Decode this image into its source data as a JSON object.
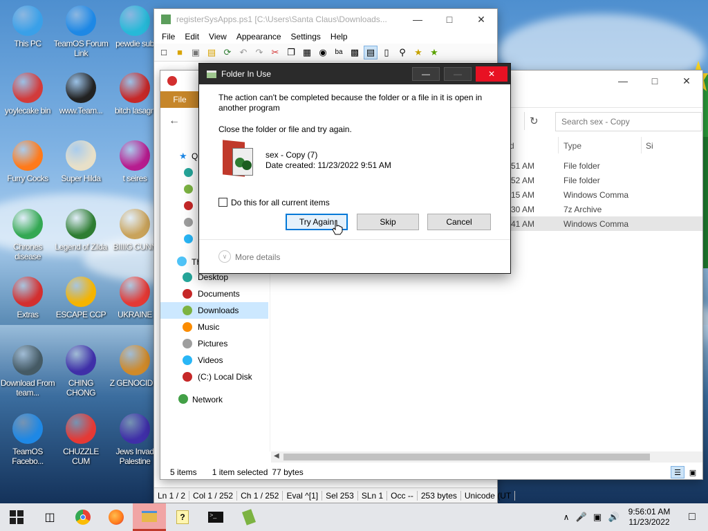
{
  "desktop": {
    "icons": [
      {
        "label": "This PC",
        "icon": "computer-icon",
        "color": "#3aa0e8"
      },
      {
        "label": "TeamOS Forum Link",
        "icon": "gear-icon",
        "color": "#1e88e5"
      },
      {
        "label": "pewdie sub",
        "icon": "diamond-icon",
        "color": "#27b9d8"
      },
      {
        "label": "yoylecake bin",
        "icon": "recycle-bin-icon",
        "color": "#d23b3b"
      },
      {
        "label": "www.Team...",
        "icon": "book-icon",
        "color": "#222222"
      },
      {
        "label": "bitch lasagn",
        "icon": "number-two-icon",
        "color": "#c62828"
      },
      {
        "label": "Furry Cocks",
        "icon": "firefox-icon",
        "color": "#ff7a1a"
      },
      {
        "label": "Super Hilda",
        "icon": "dog-icon",
        "color": "#e8e0c8"
      },
      {
        "label": "t seires",
        "icon": "gem-icon",
        "color": "#b71c8f"
      },
      {
        "label": "Chrones disease",
        "icon": "chrome-icon",
        "color": "#34a853"
      },
      {
        "label": "Legend of Zilda",
        "icon": "hero-icon",
        "color": "#2e7d32"
      },
      {
        "label": "BIIIIG CUNN",
        "icon": "money-bag-icon",
        "color": "#c9a35b"
      },
      {
        "label": "Extras",
        "icon": "gift-icon",
        "color": "#d32f2f"
      },
      {
        "label": "ESCAPE CCP",
        "icon": "coin-icon",
        "color": "#f5b400"
      },
      {
        "label": "UKRAINE",
        "icon": "radiation-icon",
        "color": "#e53935"
      },
      {
        "label": "Download From team...",
        "icon": "document-icon",
        "color": "#455a64"
      },
      {
        "label": "CHING CHONG",
        "icon": "ornament-ball-icon",
        "color": "#3f2fa8"
      },
      {
        "label": "Z GENOCIDIS",
        "icon": "cube-icon",
        "color": "#d08a2a"
      },
      {
        "label": "TeamOS Facebo...",
        "icon": "gear-icon",
        "color": "#1e88e5"
      },
      {
        "label": "CHUZZLE CUM",
        "icon": "fuzzball-icon",
        "color": "#e53935"
      },
      {
        "label": "Jews Invad Palestine",
        "icon": "ornament-ball-icon",
        "color": "#3f2fa8"
      }
    ]
  },
  "editor": {
    "title": "registerSysApps.ps1 [C:\\Users\\Santa Claus\\Downloads...",
    "menu": [
      "File",
      "Edit",
      "View",
      "Appearance",
      "Settings",
      "Help"
    ],
    "status": [
      "Ln 1 / 2",
      "Col 1 / 252",
      "Ch 1 / 252",
      "Eval ^[1]",
      "Sel 253",
      "SLn 1",
      "Occ --",
      "253 bytes",
      "Unicode (UT"
    ]
  },
  "explorer": {
    "file_tab": "File",
    "search_placeholder": "Search sex - Copy",
    "col_date_frag": "d",
    "col_type": "Type",
    "col_size_frag": "Si",
    "rows": [
      {
        "time": "51 AM",
        "type": "File folder"
      },
      {
        "time": "52 AM",
        "type": "File folder"
      },
      {
        "time": "15 AM",
        "type": "Windows Comma"
      },
      {
        "time": "30 AM",
        "type": "7z Archive"
      },
      {
        "time": "41 AM",
        "type": "Windows Comma"
      }
    ],
    "quick_frag": "Q",
    "thispc_frag": "Th",
    "nav": [
      "Desktop",
      "Documents",
      "Downloads",
      "Music",
      "Pictures",
      "Videos",
      "(C:) Local Disk"
    ],
    "network": "Network",
    "status_items": "5 items",
    "status_selected": "1 item selected",
    "status_size": "77 bytes"
  },
  "dialog": {
    "title": "Folder In Use",
    "message": "The action can't be completed because the folder or a file in it is open in another program",
    "instruction": "Close the folder or file and try again.",
    "file_name": "sex - Copy (7)",
    "file_date": "Date created: 11/23/2022 9:51 AM",
    "checkbox_label": "Do this for all current items",
    "btn_try": "Try Again",
    "btn_skip": "Skip",
    "btn_cancel": "Cancel",
    "more_details": "More details"
  },
  "taskbar": {
    "time": "9:56:01 AM",
    "date": "11/23/2022"
  },
  "colors": {
    "accent": "#0078d7",
    "explorer_file_tab": "#c6862a",
    "close_red": "#e81123",
    "selected_row": "#e5e5e5"
  }
}
